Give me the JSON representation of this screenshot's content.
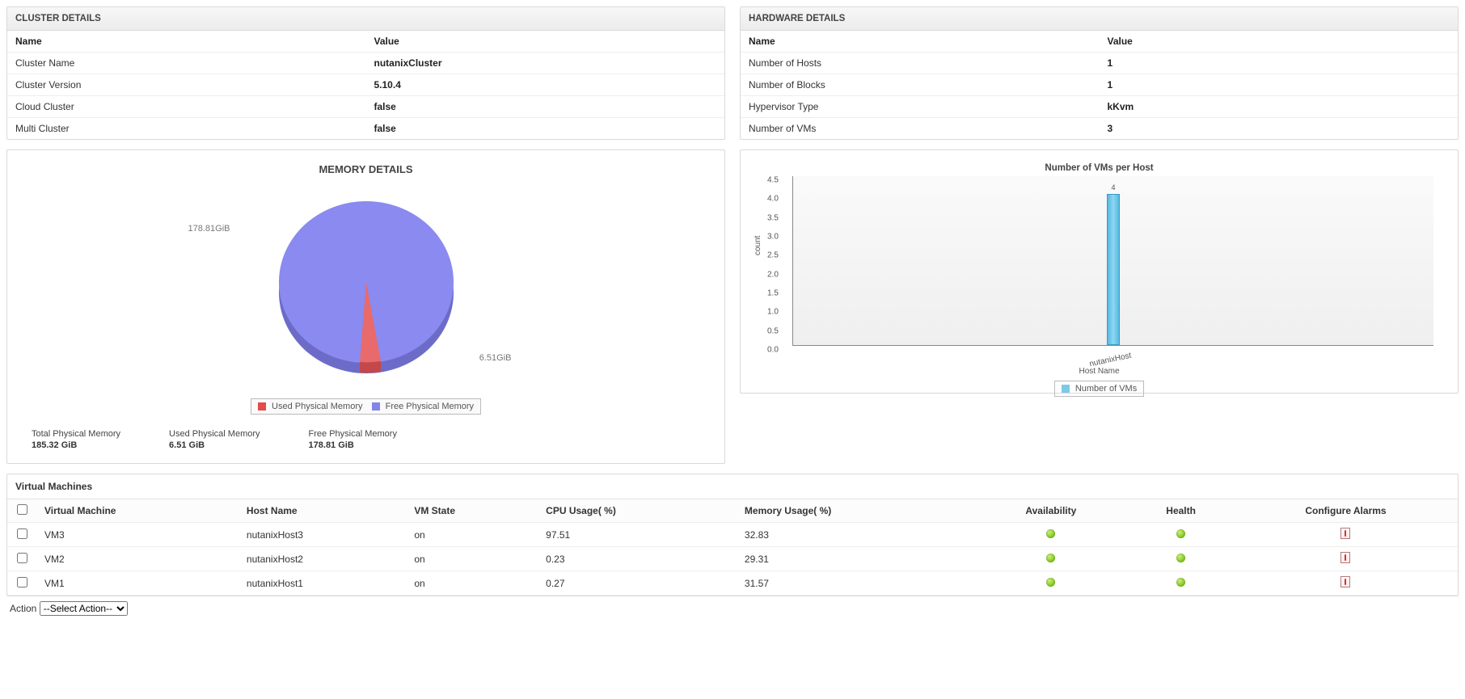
{
  "clusterDetails": {
    "title": "CLUSTER DETAILS",
    "headers": {
      "name": "Name",
      "value": "Value"
    },
    "rows": [
      {
        "name": "Cluster Name",
        "value": "nutanixCluster"
      },
      {
        "name": "Cluster Version",
        "value": "5.10.4"
      },
      {
        "name": "Cloud Cluster",
        "value": "false"
      },
      {
        "name": "Multi Cluster",
        "value": "false"
      }
    ]
  },
  "hardwareDetails": {
    "title": "HARDWARE DETAILS",
    "headers": {
      "name": "Name",
      "value": "Value"
    },
    "rows": [
      {
        "name": "Number of Hosts",
        "value": "1"
      },
      {
        "name": "Number of Blocks",
        "value": "1"
      },
      {
        "name": "Hypervisor Type",
        "value": "kKvm"
      },
      {
        "name": "Number of VMs",
        "value": "3"
      }
    ]
  },
  "memory": {
    "title": "MEMORY DETAILS",
    "leftLabel": "178.81GiB",
    "rightLabel": "6.51GiB",
    "legend": {
      "used": "Used Physical Memory",
      "free": "Free Physical Memory"
    },
    "stats": {
      "total": {
        "label": "Total Physical Memory",
        "value": "185.32 GiB"
      },
      "used": {
        "label": "Used Physical Memory",
        "value": "6.51 GiB"
      },
      "free": {
        "label": "Free Physical Memory",
        "value": "178.81 GiB"
      }
    }
  },
  "vmsPerHost": {
    "title": "Number of VMs per Host",
    "ylabel": "count",
    "xlabel": "Host Name",
    "legend": "Number of VMs"
  },
  "vmPanel": {
    "title": "Virtual Machines",
    "headers": {
      "vm": "Virtual Machine",
      "host": "Host Name",
      "state": "VM State",
      "cpu": "CPU Usage( %)",
      "mem": "Memory Usage( %)",
      "avail": "Availability",
      "health": "Health",
      "alarms": "Configure Alarms"
    },
    "rows": [
      {
        "vm": "VM3",
        "host": "nutanixHost3",
        "state": "on",
        "cpu": "97.51",
        "mem": "32.83"
      },
      {
        "vm": "VM2",
        "host": "nutanixHost2",
        "state": "on",
        "cpu": "0.23",
        "mem": "29.31"
      },
      {
        "vm": "VM1",
        "host": "nutanixHost1",
        "state": "on",
        "cpu": "0.27",
        "mem": "31.57"
      }
    ],
    "actionLabel": "Action",
    "actionOptions": [
      "--Select Action--"
    ]
  },
  "chart_data": [
    {
      "type": "pie",
      "title": "MEMORY DETAILS",
      "series": [
        {
          "name": "Used Physical Memory",
          "value": 6.51,
          "unit": "GiB",
          "color": "#e34a4a"
        },
        {
          "name": "Free Physical Memory",
          "value": 178.81,
          "unit": "GiB",
          "color": "#8484e8"
        }
      ],
      "total": 185.32
    },
    {
      "type": "bar",
      "title": "Number of VMs per Host",
      "xlabel": "Host Name",
      "ylabel": "count",
      "categories": [
        "nutanixHost"
      ],
      "series": [
        {
          "name": "Number of VMs",
          "values": [
            4
          ],
          "color": "#7ccaea"
        }
      ],
      "ylim": [
        0,
        4.5
      ],
      "yticks": [
        0.0,
        0.5,
        1.0,
        1.5,
        2.0,
        2.5,
        3.0,
        3.5,
        4.0,
        4.5
      ]
    }
  ]
}
